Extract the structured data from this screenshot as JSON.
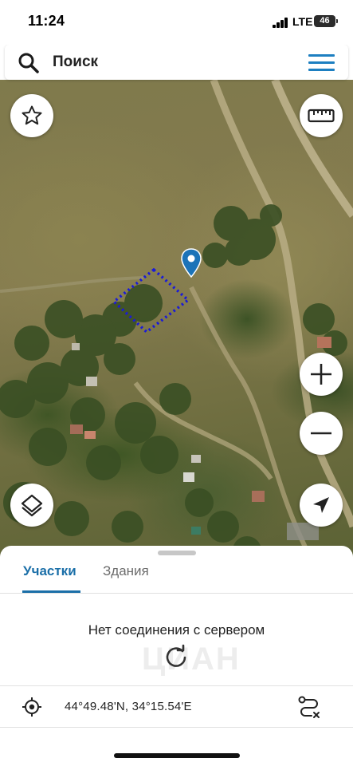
{
  "status_bar": {
    "time": "11:24",
    "network": "LTE",
    "battery_level": "46",
    "icons": [
      "signal-bars-icon",
      "battery-icon"
    ]
  },
  "search": {
    "placeholder": "Поиск",
    "icons": [
      "search-icon",
      "hamburger-menu-icon"
    ]
  },
  "map": {
    "controls": [
      "favorites-star-icon",
      "ruler-icon",
      "zoom-in-icon",
      "zoom-out-icon",
      "layers-icon",
      "my-location-arrow-icon"
    ],
    "marker_color": "#1b73b8",
    "parcel_outline_color": "#1a1ad8"
  },
  "sheet": {
    "tabs": [
      {
        "label": "Участки",
        "active": true
      },
      {
        "label": "Здания",
        "active": false
      }
    ],
    "error_message": "Нет соединения с сервером",
    "watermark": "ЦИАН",
    "coordinates": "44°49.48'N, 34°15.54'E",
    "accent_color": "#1b6fa8",
    "icons": [
      "refresh-icon",
      "crosshair-icon",
      "route-icon"
    ]
  }
}
